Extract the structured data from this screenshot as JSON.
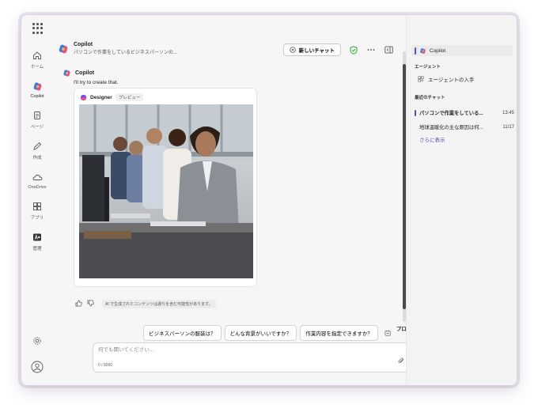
{
  "rail": {
    "items": [
      {
        "label": "ホーム",
        "icon": "home-icon"
      },
      {
        "label": "Copilot",
        "icon": "copilot-icon"
      },
      {
        "label": "ページ",
        "icon": "page-icon"
      },
      {
        "label": "作成",
        "icon": "create-icon"
      },
      {
        "label": "OneDrive",
        "icon": "onedrive-icon"
      },
      {
        "label": "アプリ",
        "icon": "apps-icon"
      },
      {
        "label": "管理",
        "icon": "admin-icon"
      }
    ]
  },
  "header": {
    "title": "Copilot",
    "subtitle": "パソコンで作業をしているビジネスパーソンの...",
    "new_chat_label": "新しいチャット"
  },
  "message": {
    "author": "Copilot",
    "text": "I'll try to create that.",
    "card_title": "Designer",
    "card_badge": "プレビュー",
    "ai_note": "AI で生成されたコンテンツは誤りを含む可能性があります。"
  },
  "suggestions": [
    "ビジネスパーソンの服装は？",
    "どんな背景がいいですか？",
    "作業内容を指定できますか？"
  ],
  "prompt_button_label": "プロンプトを表示する",
  "composer": {
    "placeholder": "何でも聞いてください...",
    "count": "0 / 8000"
  },
  "panel": {
    "copilot_label": "Copilot",
    "agents_title": "エージェント",
    "agent_item": "エージェントの入手",
    "recent_title": "最近のチャット",
    "chats": [
      {
        "title": "パソコンで作業をしている...",
        "time": "13:45",
        "active": true
      },
      {
        "title": "地球温暖化の主な原因は何...",
        "time": "11/17",
        "active": false
      }
    ],
    "show_more": "さらに表示"
  },
  "colors": {
    "accent": "#4f52b2",
    "shield": "#13a10e"
  }
}
